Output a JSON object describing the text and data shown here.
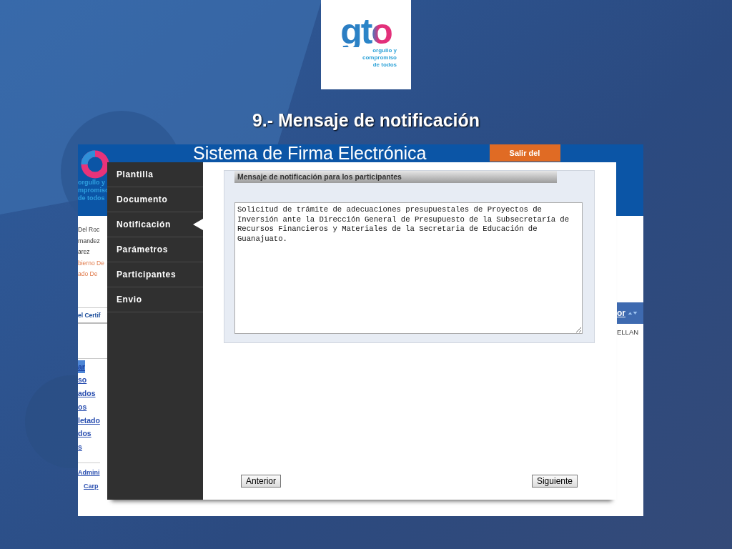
{
  "slide": {
    "title": "9.- Mensaje de notificación",
    "logo": {
      "wordmark": "gto",
      "tagline": [
        "orgullo y",
        "compromiso",
        "de todos"
      ]
    }
  },
  "background_page": {
    "header_title": "Sistema de Firma Electrónica",
    "logo_tagline": [
      "orgullo y",
      "mpromiso",
      "de todos"
    ],
    "exit_button": "Salir del",
    "user_lines": [
      {
        "text": "Del Roc",
        "kind": "plain"
      },
      {
        "text": "rnandez",
        "kind": "plain"
      },
      {
        "text": "arez",
        "kind": "plain"
      },
      {
        "text": "bierno De",
        "kind": "accent"
      },
      {
        "text": "ado De",
        "kind": "accent"
      }
    ],
    "section_tab": "el Certif",
    "links": [
      {
        "text": "ar",
        "selected": true
      },
      {
        "text": "so",
        "selected": false
      },
      {
        "text": "ados",
        "selected": false
      },
      {
        "text": "os",
        "selected": false
      },
      {
        "text": "letado",
        "selected": false
      },
      {
        "text": "dos",
        "selected": false
      },
      {
        "text": "s",
        "selected": false
      }
    ],
    "admin_link": "Admini",
    "folder_link": "Carp",
    "column_header": "or",
    "cell": "ELLAN"
  },
  "dialog": {
    "steps": [
      {
        "label": "Plantilla",
        "selected": false
      },
      {
        "label": "Documento",
        "selected": false
      },
      {
        "label": "Notificación",
        "selected": true
      },
      {
        "label": "Parámetros",
        "selected": false
      },
      {
        "label": "Participantes",
        "selected": false
      },
      {
        "label": "Envio",
        "selected": false
      }
    ],
    "panel_title": "Mensaje de notificación para los participantes",
    "message": "Solicitud de trámite de adecuaciones presupuestales de Proyectos de Inversión ante la Dirección General de Presupuesto de la Subsecretaría de Recursos Financieros y Materiales de la Secretaria de Educación de Guanajuato.",
    "buttons": [
      "Anterior",
      "Siguiente"
    ]
  }
}
